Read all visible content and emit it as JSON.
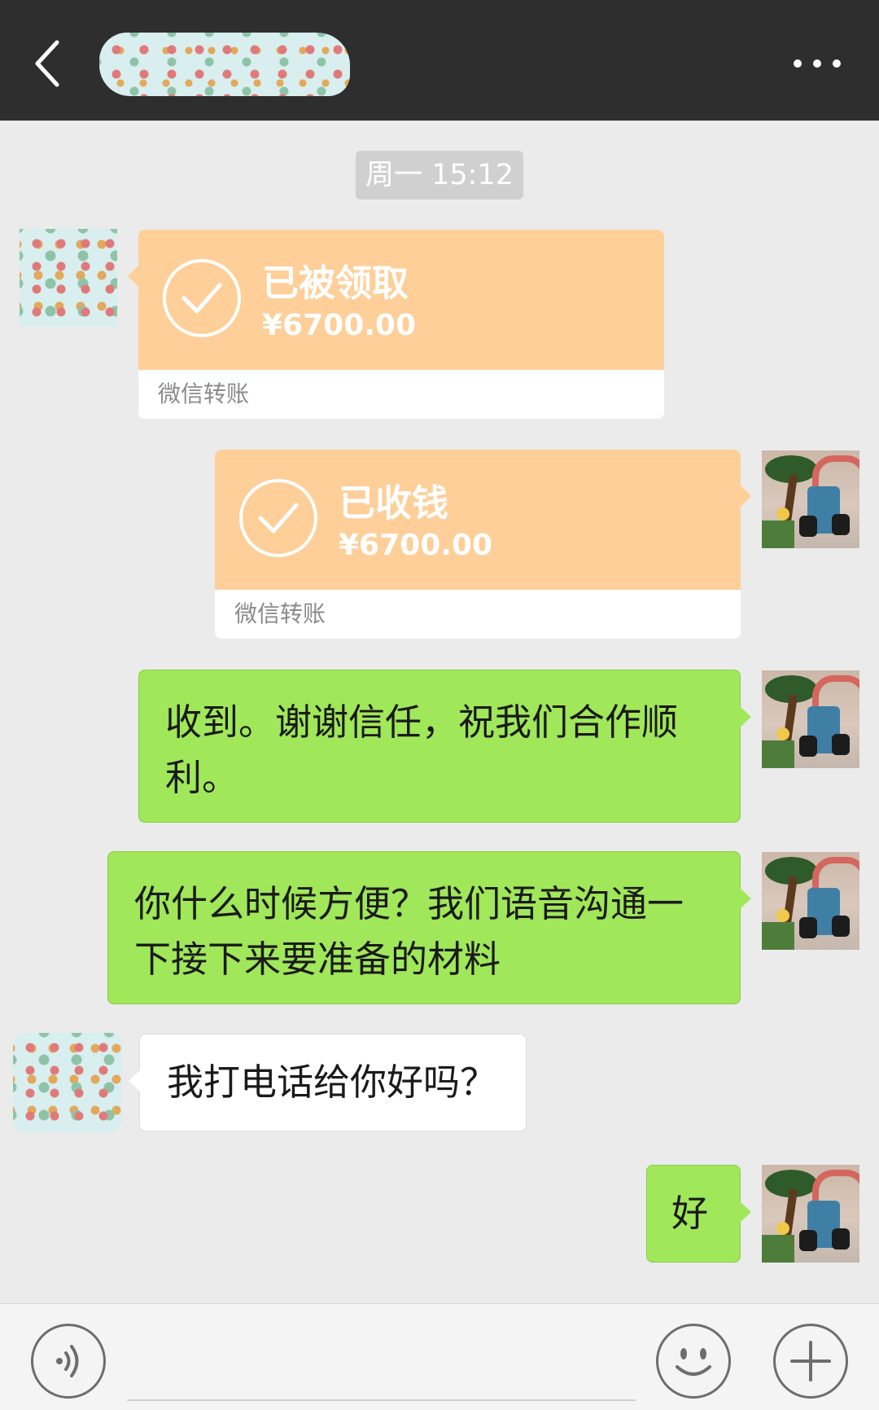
{
  "header": {
    "back_icon": "chevron-left-icon",
    "more_icon": "ellipsis-icon",
    "title_obscured": true
  },
  "timestamp": "周一 15:12",
  "messages": [
    {
      "type": "transfer",
      "side": "left",
      "title": "已被领取",
      "amount": "¥6700.00",
      "label": "微信转账"
    },
    {
      "type": "transfer",
      "side": "right",
      "title": "已收钱",
      "amount": "¥6700.00",
      "label": "微信转账"
    },
    {
      "type": "text",
      "side": "right",
      "lines": [
        "收到。谢谢信任，祝我们合作顺",
        "利。"
      ]
    },
    {
      "type": "text",
      "side": "right",
      "lines": [
        "你什么时候方便？我们语音沟通一",
        "下接下来要准备的材料"
      ]
    },
    {
      "type": "text",
      "side": "left",
      "lines": [
        "我打电话给你好吗？"
      ]
    },
    {
      "type": "text",
      "side": "right",
      "lines": [
        "好"
      ]
    }
  ],
  "bottom_bar": {
    "voice_icon": "voice-icon",
    "emoji_icon": "smiley-icon",
    "plus_icon": "plus-icon"
  },
  "colors": {
    "header_bg": "#2e2e2e",
    "chat_bg": "#ebebeb",
    "transfer_orange": "#fecf99",
    "bubble_green": "#a0e75a",
    "bubble_white": "#ffffff"
  }
}
